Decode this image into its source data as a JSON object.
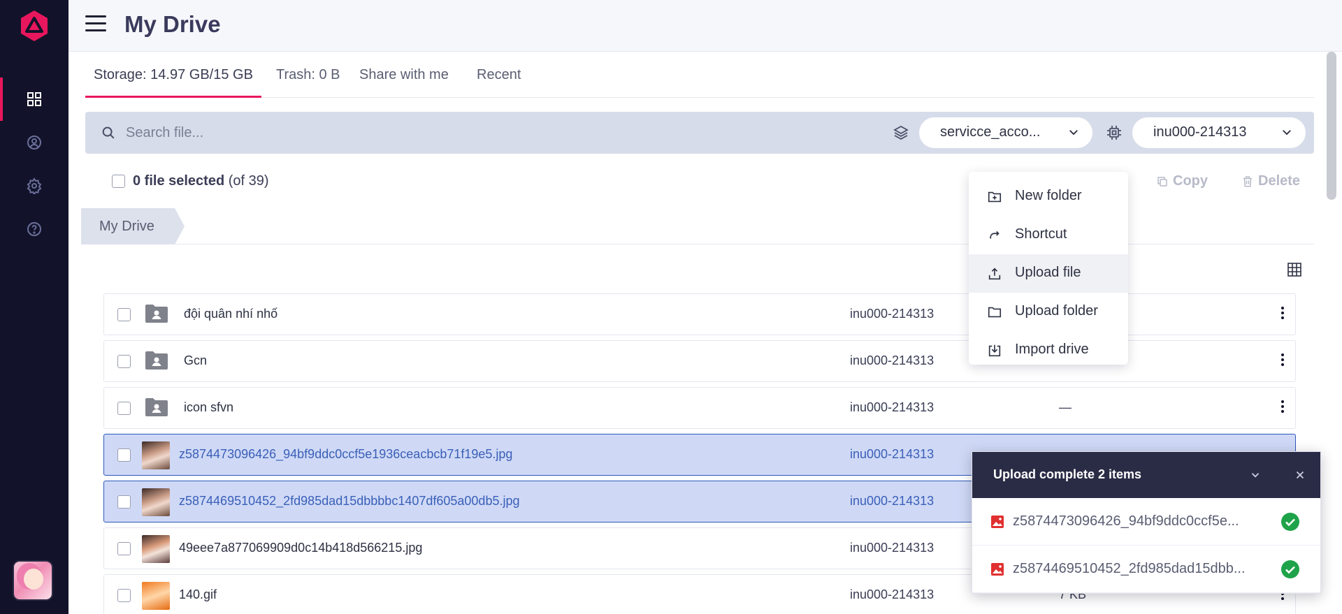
{
  "header": {
    "title": "My Drive"
  },
  "tabs": [
    {
      "label": "Storage: 14.97 GB/15 GB"
    },
    {
      "label": "Trash: 0 B"
    },
    {
      "label": "Share with me"
    },
    {
      "label": "Recent"
    }
  ],
  "search": {
    "placeholder": "Search file..."
  },
  "account_select": {
    "value": "servicce_acco..."
  },
  "drive_select": {
    "value": "inu000-214313"
  },
  "selection": {
    "count_text": "0 file selected",
    "total_text": "(of 39)"
  },
  "actions": {
    "copy": "Copy",
    "delete": "Delete"
  },
  "breadcrumb": {
    "root": "My Drive"
  },
  "menu": {
    "items": [
      {
        "label": "New folder",
        "icon": "folder-plus-icon"
      },
      {
        "label": "Shortcut",
        "icon": "shortcut-arrow-icon"
      },
      {
        "label": "Upload file",
        "icon": "upload-icon"
      },
      {
        "label": "Upload folder",
        "icon": "folder-icon"
      },
      {
        "label": "Import drive",
        "icon": "import-icon"
      }
    ]
  },
  "files": [
    {
      "name": "đội quân nhí nhố",
      "owner": "inu000-214313",
      "size": "",
      "type": "shared-folder",
      "selected": false
    },
    {
      "name": "Gcn",
      "owner": "inu000-214313",
      "size": "",
      "type": "shared-folder",
      "selected": false
    },
    {
      "name": "icon sfvn",
      "owner": "inu000-214313",
      "size": "—",
      "type": "shared-folder",
      "selected": false
    },
    {
      "name": "z5874473096426_94bf9ddc0ccf5e1936ceacbcb71f19e5.jpg",
      "owner": "inu000-214313",
      "size": "",
      "type": "image",
      "selected": true
    },
    {
      "name": "z5874469510452_2fd985dad15dbbbbc1407df605a00db5.jpg",
      "owner": "inu000-214313",
      "size": "",
      "type": "image",
      "selected": true
    },
    {
      "name": "49eee7a877069909d0c14b418d566215.jpg",
      "owner": "inu000-214313",
      "size": "",
      "type": "image",
      "selected": false
    },
    {
      "name": "140.gif",
      "owner": "inu000-214313",
      "size": "7 KB",
      "type": "image",
      "selected": false
    }
  ],
  "upload_panel": {
    "title": "Upload complete 2 items",
    "items": [
      {
        "name": "z5874473096426_94bf9ddc0ccf5e..."
      },
      {
        "name": "z5874469510452_2fd985dad15dbb..."
      }
    ]
  },
  "colors": {
    "accent": "#e8175d",
    "sidebar": "#12132a",
    "success": "#1fa34a",
    "selected_row": "#cfd9f6"
  }
}
